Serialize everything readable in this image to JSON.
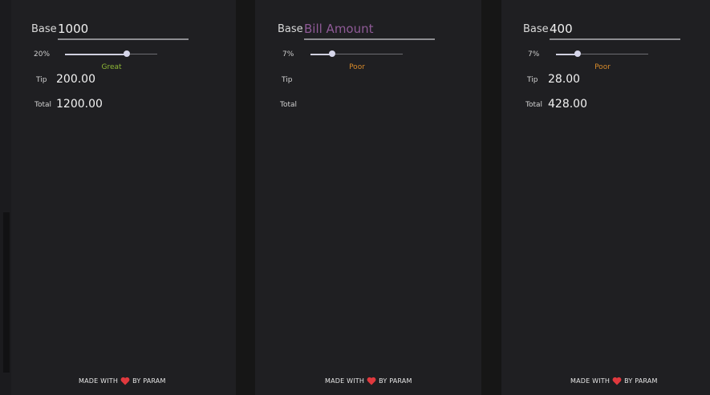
{
  "colors": {
    "great": "#8fb935",
    "poor": "#d98b2a",
    "heart": "#e0393e",
    "placeholder": "#8f5a97"
  },
  "panels": [
    {
      "base_label": "Base",
      "base_value": "1000",
      "base_placeholder": "Bill Amount",
      "tip_percent_label": "20%",
      "tip_percent": 20,
      "rating": "Great",
      "tip_label": "Tip",
      "tip_value": "200.00",
      "total_label": "Total",
      "total_value": "1200.00",
      "footer_left": "MADE WITH",
      "footer_right": "BY PARAM",
      "heart_icon": "heart-icon"
    },
    {
      "base_label": "Base",
      "base_value": "",
      "base_placeholder": "Bill Amount",
      "tip_percent_label": "7%",
      "tip_percent": 7,
      "rating": "Poor",
      "tip_label": "Tip",
      "tip_value": "",
      "total_label": "Total",
      "total_value": "",
      "footer_left": "MADE WITH",
      "footer_right": "BY PARAM",
      "heart_icon": "heart-icon"
    },
    {
      "base_label": "Base",
      "base_value": "400",
      "base_placeholder": "Bill Amount",
      "tip_percent_label": "7%",
      "tip_percent": 7,
      "rating": "Poor",
      "tip_label": "Tip",
      "tip_value": "28.00",
      "total_label": "Total",
      "total_value": "428.00",
      "footer_left": "MADE WITH",
      "footer_right": "BY PARAM",
      "heart_icon": "heart-icon"
    }
  ]
}
